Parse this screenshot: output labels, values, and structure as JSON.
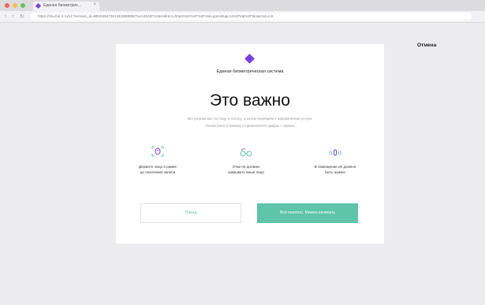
{
  "browser": {
    "tab_title": "Единая биометрич…",
    "tab_close": "×",
    "back": "‹",
    "forward": "›",
    "reload": "↻",
    "url": "https://zsu.bio.rt.ru/v1?session_id=8B194547281342808B9571eA26AB712&redirect=https%3A%2F%2Fesia.gosuslugi.ru%2Fidp%2Fbio&cmd=init"
  },
  "cancel_label": "Отмена",
  "card": {
    "system_name": "Единая биометрическая система",
    "heading": "Это важно",
    "description": [
      "Мы узнаем вас по лицу и голосу, а затем перейдём к оформлению услуги.",
      "Посмотрите в камеру и произнесите цифры с экрана"
    ],
    "features": [
      {
        "icon": "face-frame-icon",
        "lines": [
          "Держите лицо в рамке",
          "до окончания записи"
        ]
      },
      {
        "icon": "glasses-icon",
        "lines": [
          "Очки не должны",
          "закрывать ваше лицо"
        ]
      },
      {
        "icon": "sound-icon",
        "lines": [
          "В помещении не должно",
          "быть шумно"
        ]
      }
    ],
    "back_label": "Назад",
    "ok_label": "Всё понятно. Можно начинать"
  },
  "colors": {
    "accent": "#5ec4aa",
    "brand": "#7b3fe0"
  }
}
